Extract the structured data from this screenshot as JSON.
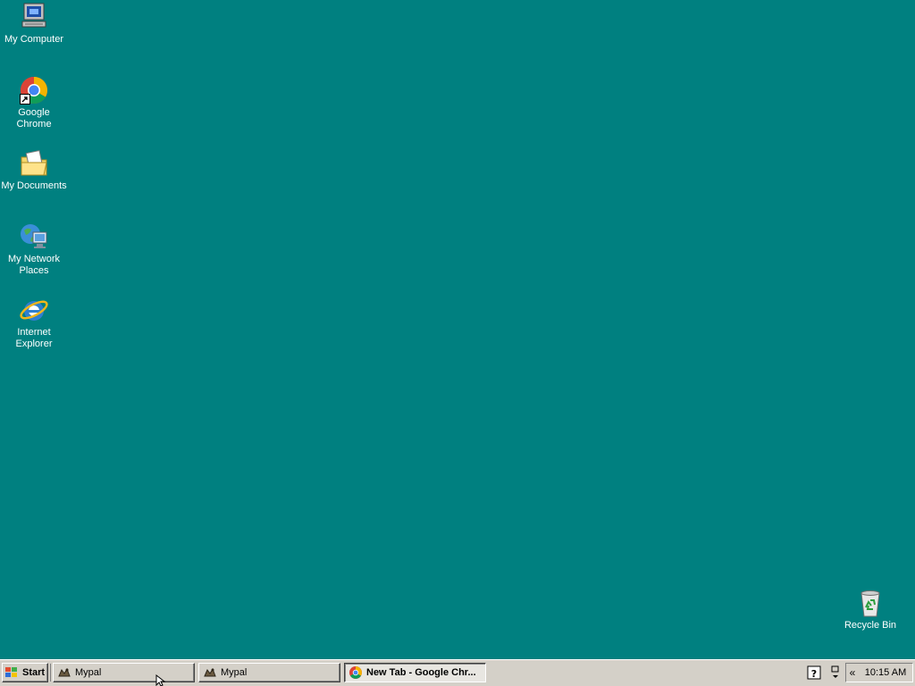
{
  "desktop": {
    "background": "#008080",
    "icons": [
      {
        "label": "My Computer",
        "icon": "computer-icon"
      },
      {
        "label": "Google Chrome",
        "icon": "chrome-icon"
      },
      {
        "label": "My Documents",
        "icon": "documents-folder-icon"
      },
      {
        "label": "My Network Places",
        "icon": "network-places-icon"
      },
      {
        "label": "Internet Explorer",
        "icon": "ie-icon"
      },
      {
        "label": "Recycle Bin",
        "icon": "recycle-bin-icon"
      }
    ]
  },
  "taskbar": {
    "start_label": "Start",
    "tasks": [
      {
        "label": "Mypal",
        "icon": "mypal-icon",
        "active": false
      },
      {
        "label": "Mypal",
        "icon": "mypal-icon",
        "active": false
      },
      {
        "label": "New Tab - Google Chr...",
        "icon": "chrome-icon",
        "active": true
      }
    ],
    "tray": {
      "chevron": "«",
      "clock": "10:15 AM"
    }
  }
}
